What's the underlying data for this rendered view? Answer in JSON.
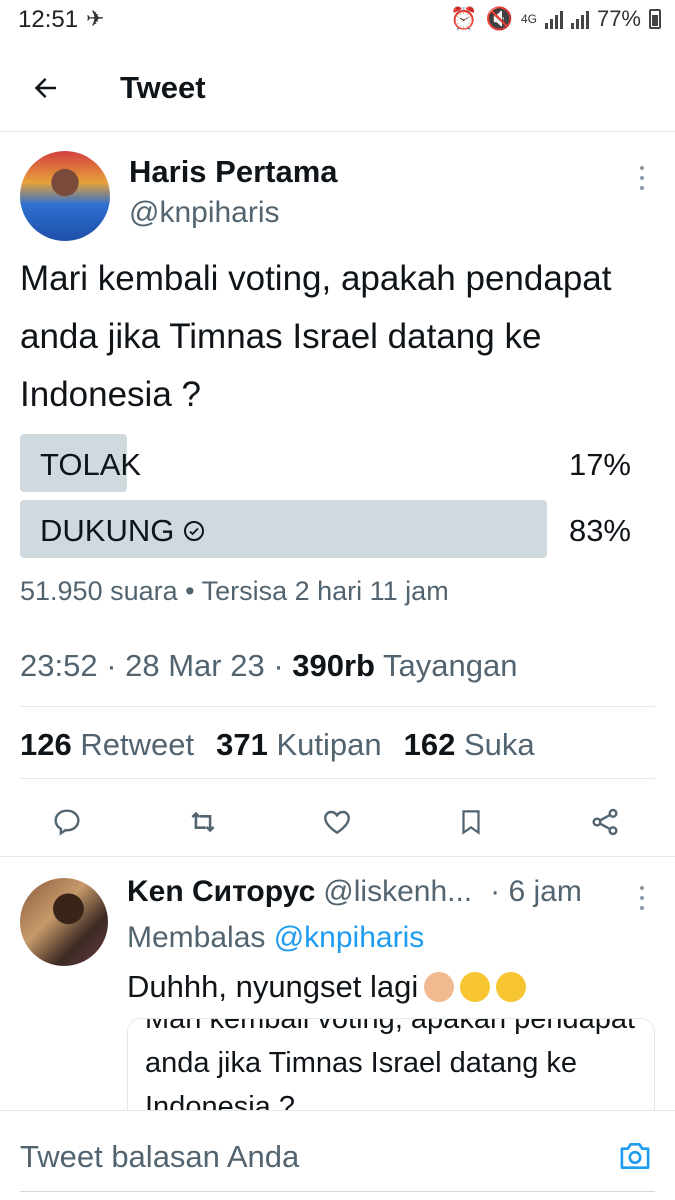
{
  "status_bar": {
    "time": "12:51",
    "battery": "77%",
    "network": "4G"
  },
  "header": {
    "title": "Tweet"
  },
  "tweet": {
    "author_name": "Haris Pertama",
    "author_handle": "@knpiharis",
    "text": "Mari kembali voting, apakah pendapat anda jika Timnas Israel datang ke Indonesia ?",
    "poll": {
      "options": [
        {
          "label": "TOLAK",
          "percent_text": "17%",
          "percent": 17
        },
        {
          "label": "DUKUNG",
          "percent_text": "83%",
          "percent": 83
        }
      ],
      "meta": "51.950 suara • Tersisa 2 hari 11 jam"
    },
    "timestamp": "23:52 · 28 Mar 23 · ",
    "views_count": "390rb",
    "views_label": " Tayangan",
    "stats": {
      "retweets_count": "126",
      "retweets_label": "Retweet",
      "quotes_count": "371",
      "quotes_label": "Kutipan",
      "likes_count": "162",
      "likes_label": "Suka"
    }
  },
  "reply": {
    "author_name": "Ken Ситорус",
    "author_handle": "@liskenh...",
    "time": "· 6 jam",
    "replying_prefix": "Membalas ",
    "replying_to": "@knpiharis",
    "text": "Duhhh, nyungset lagi",
    "quote_text": "Mari kembali voting, apakah pendapat anda jika Timnas Israel datang ke Indonesia ?"
  },
  "compose": {
    "placeholder": "Tweet balasan Anda"
  },
  "colors": {
    "accent": "#1d9bf0",
    "poll_fill": "#cfd9de",
    "secondary_text": "#536471"
  }
}
